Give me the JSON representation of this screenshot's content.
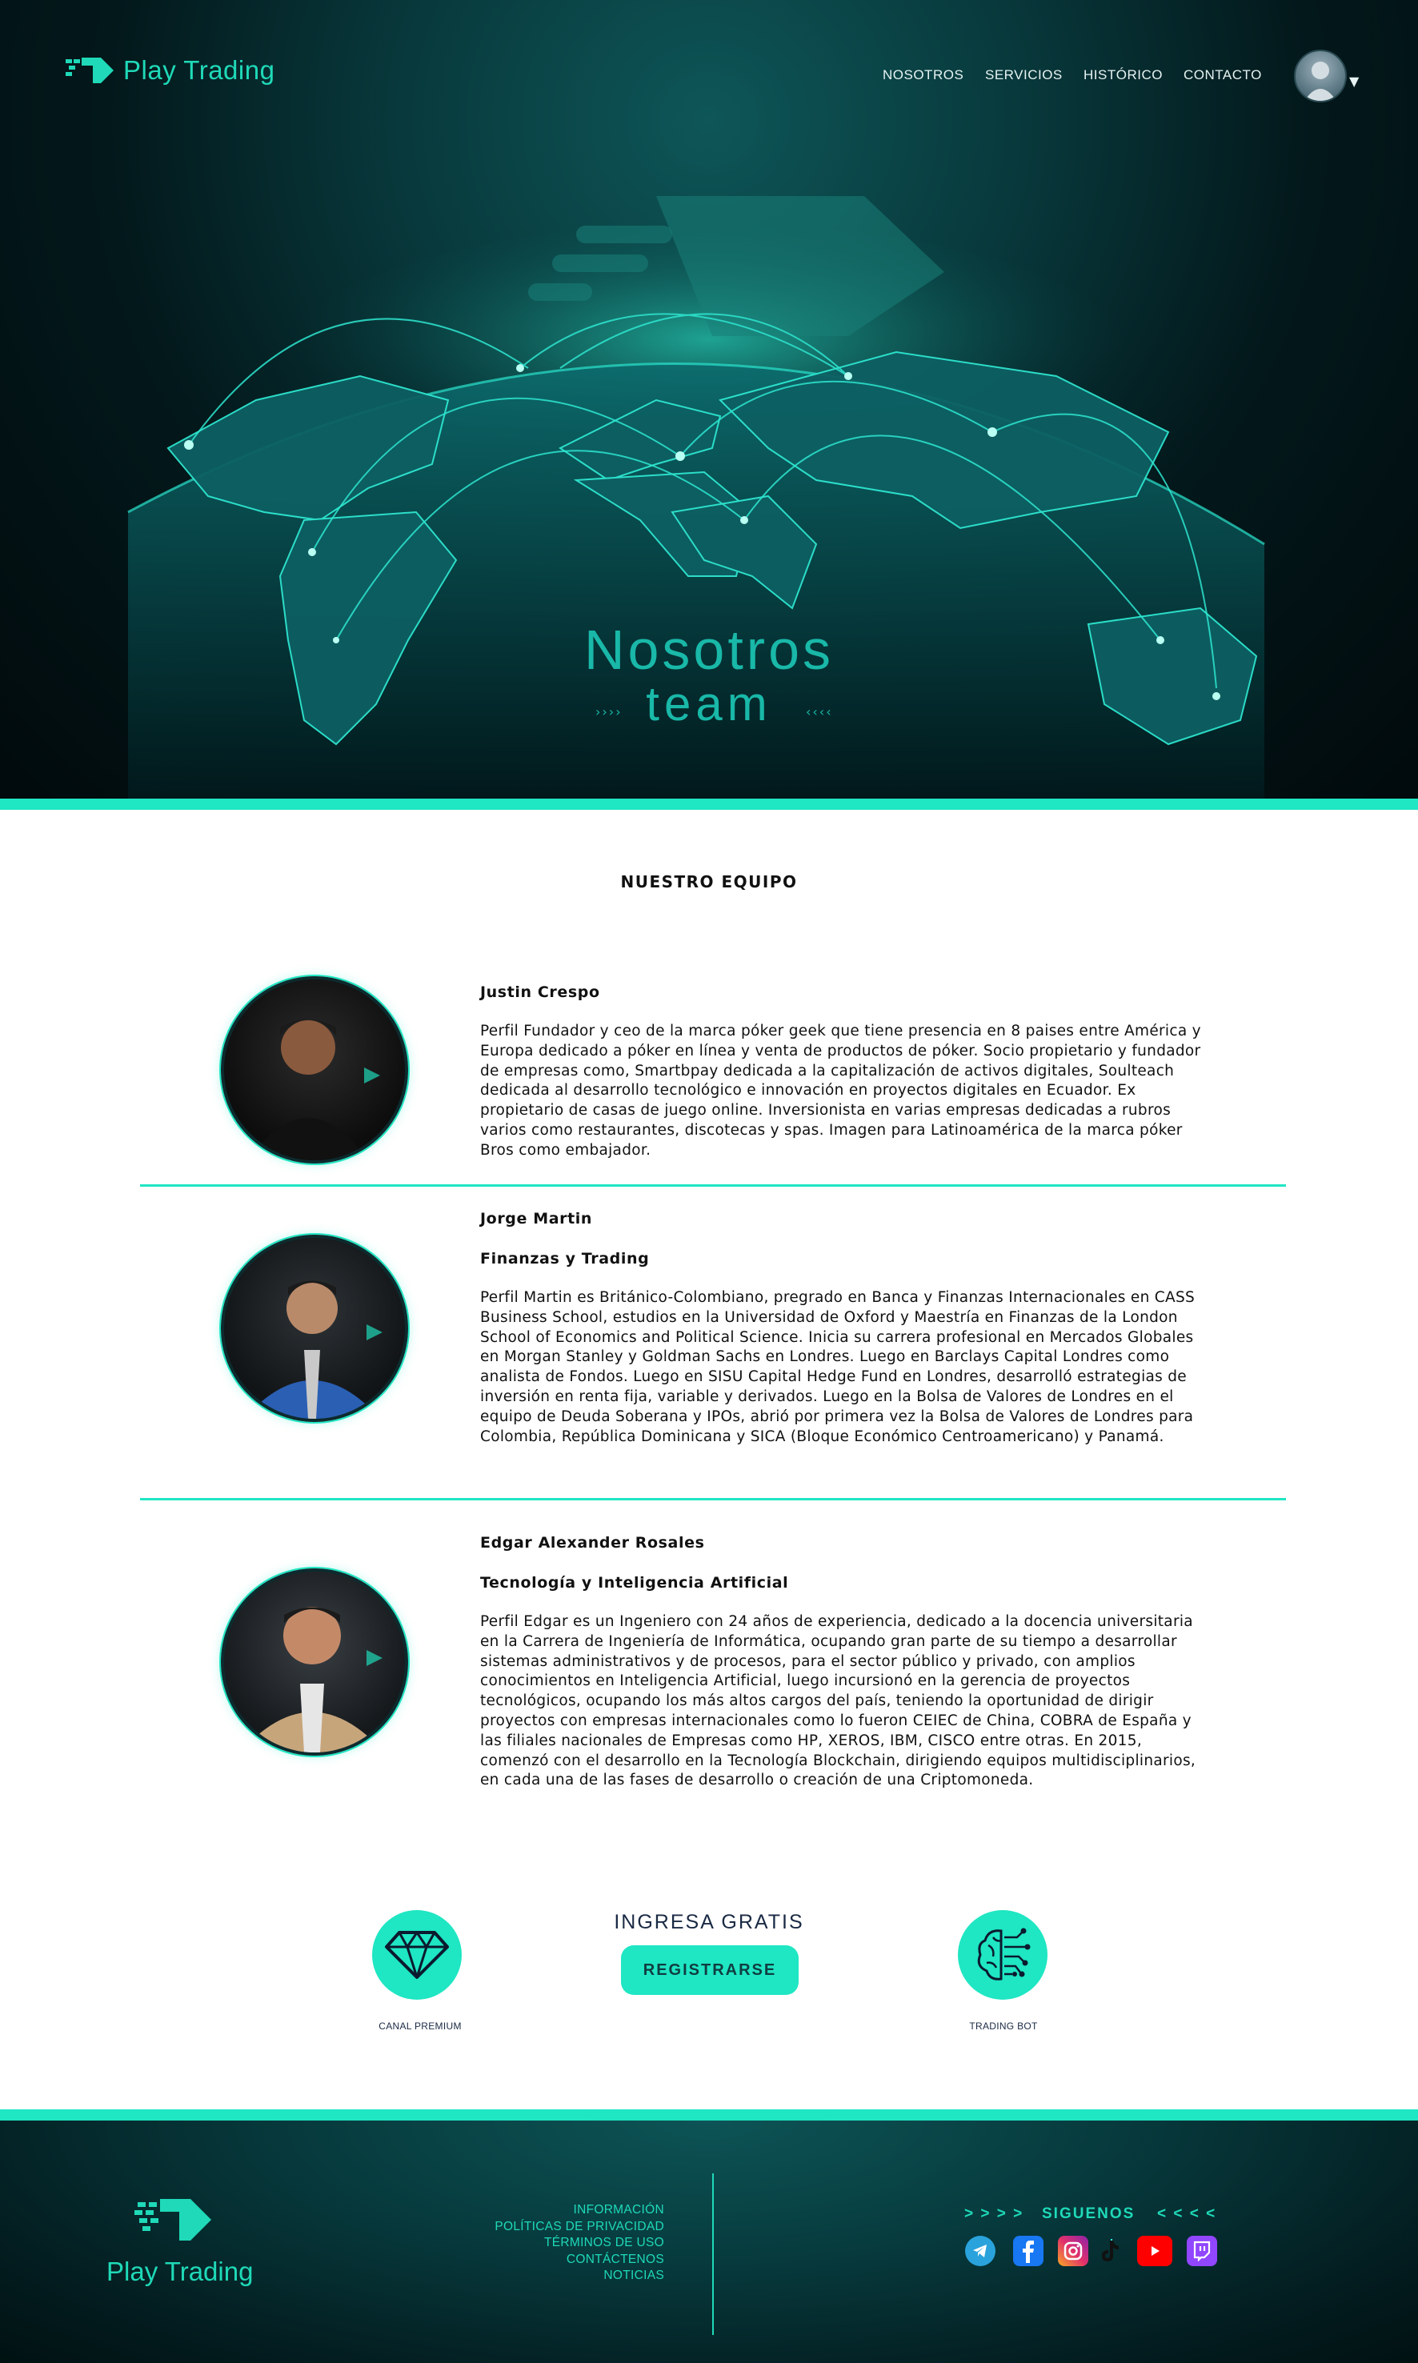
{
  "header": {
    "logo_text": "Play Trading",
    "nav": [
      "NOSOTROS",
      "SERVICIOS",
      "HISTÓRICO",
      "CONTACTO"
    ]
  },
  "hero": {
    "title": "Nosotros",
    "subtitle": "team",
    "left_arrows": "››››",
    "right_arrows": "‹‹‹‹"
  },
  "team": {
    "title": "NUESTRO EQUIPO",
    "members": [
      {
        "name": "Justin Crespo",
        "role": "",
        "bio": "Perfil Fundador y ceo de la marca póker geek que tiene presencia en 8 paises entre América y Europa dedicado a póker en línea y venta de productos de póker. Socio propietario y fundador de empresas como, Smartbpay dedicada a la capitalización de activos digitales, Soulteach  dedicada al desarrollo tecnológico e innovación en proyectos digitales en Ecuador. Ex propietario de casas de juego online. Inversionista en varias empresas dedicadas a rubros varios como restaurantes, discotecas y spas. Imagen para Latinoamérica de la marca póker Bros como embajador."
      },
      {
        "name": "Jorge Martin",
        "role": "Finanzas y Trading",
        "bio": "Perfil Martin es Británico-Colombiano, pregrado en Banca y Finanzas Internacionales en CASS Business School, estudios en la Universidad de Oxford y Maestría en Finanzas de la London School of Economics and Political Science. Inicia su carrera profesional en Mercados Globales en Morgan Stanley y Goldman Sachs en Londres. Luego en Barclays Capital Londres como analista de Fondos. Luego en SISU Capital Hedge Fund en Londres, desarrolló estrategias de inversión en renta fija, variable y derivados. Luego en la Bolsa de Valores de Londres en el equipo de Deuda Soberana y IPOs, abrió por primera vez la Bolsa de Valores de Londres para Colombia, República Dominicana y SICA (Bloque Económico Centroamericano) y Panamá."
      },
      {
        "name": "Edgar Alexander Rosales",
        "role": "Tecnología y Inteligencia Artificial",
        "bio": "Perfil Edgar es un Ingeniero con 24 años de experiencia, dedicado a la docencia universitaria en la Carrera de Ingeniería de Informática, ocupando gran parte de su tiempo a desarrollar sistemas administrativos y de procesos, para el sector público y privado, con amplios conocimientos en Inteligencia Artificial, luego incursionó en la gerencia de proyectos tecnológicos, ocupando los más altos cargos del país, teniendo la oportunidad de dirigir proyectos con empresas internacionales como lo fueron CEIEC de China, COBRA de España y las filiales nacionales de Empresas como HP, XEROS, IBM, CISCO entre otras. En 2015, comenzó con el desarrollo en la Tecnología Blockchain, dirigiendo equipos multidisciplinarios, en cada una de las fases de desarrollo o creación de una Criptomoneda."
      }
    ]
  },
  "cta": {
    "left_label": "CANAL PREMIUM",
    "center_heading": "INGRESA GRATIS",
    "button_label": "REGISTRARSE",
    "right_label": "TRADING BOT",
    "accent": "#1fe6c3"
  },
  "footer": {
    "logo_text": "Play Trading",
    "links": [
      "INFORMACIÓN",
      "POLÍTICAS DE PRIVACIDAD",
      "TÉRMINOS DE USO",
      "CONTÁCTENOS",
      "NOTICIAS"
    ],
    "follow_left": "> > > >",
    "follow_label": "SIGUENOS",
    "follow_right": "< < < <",
    "social": [
      "telegram-icon",
      "facebook-icon",
      "instagram-icon",
      "tiktok-icon",
      "youtube-icon",
      "twitch-icon"
    ]
  }
}
